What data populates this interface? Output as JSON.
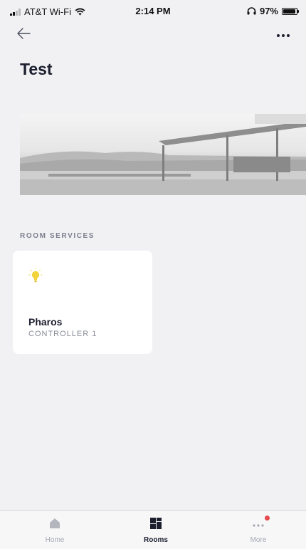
{
  "status_bar": {
    "carrier": "AT&T Wi-Fi",
    "time": "2:14 PM",
    "battery": "97%",
    "battery_level": 0.97
  },
  "header": {
    "back_icon": "arrow-left-icon",
    "more_icon": "ellipsis-icon"
  },
  "page": {
    "title": "Test",
    "section_label": "ROOM SERVICES"
  },
  "services": [
    {
      "name": "Pharos",
      "subtitle": "CONTROLLER 1",
      "icon": "lightbulb-icon",
      "icon_color": "#f2d43a"
    }
  ],
  "tab_bar": {
    "home": "Home",
    "rooms": "Rooms",
    "more": "More",
    "active": "rooms",
    "notification_color": "#e5484d"
  }
}
